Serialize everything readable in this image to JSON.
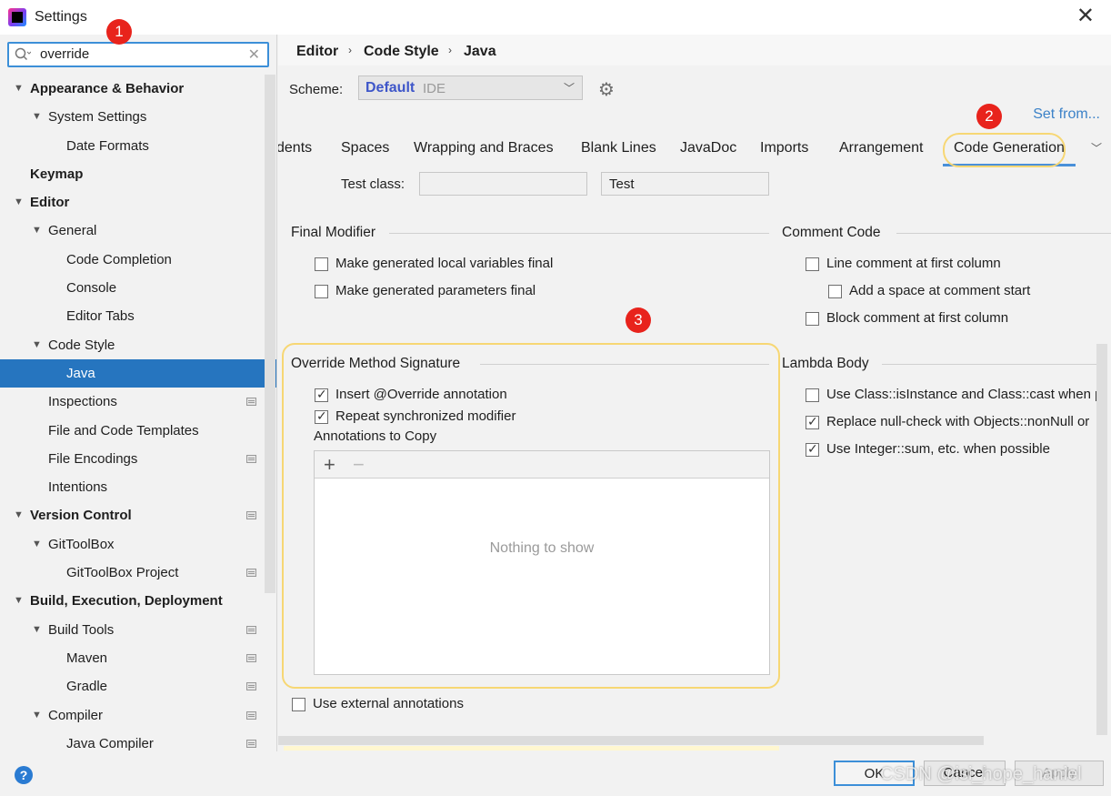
{
  "window": {
    "title": "Settings"
  },
  "search": {
    "value": "override"
  },
  "tree": [
    {
      "label": "Appearance & Behavior",
      "level": 0,
      "expanded": true,
      "bold": true
    },
    {
      "label": "System Settings",
      "level": 1,
      "expanded": true
    },
    {
      "label": "Date Formats",
      "level": 2
    },
    {
      "label": "Keymap",
      "level": 0,
      "bold": true
    },
    {
      "label": "Editor",
      "level": 0,
      "expanded": true,
      "bold": true
    },
    {
      "label": "General",
      "level": 1,
      "expanded": true
    },
    {
      "label": "Code Completion",
      "level": 2
    },
    {
      "label": "Console",
      "level": 2
    },
    {
      "label": "Editor Tabs",
      "level": 2
    },
    {
      "label": "Code Style",
      "level": 1,
      "expanded": true
    },
    {
      "label": "Java",
      "level": 2,
      "selected": true
    },
    {
      "label": "Inspections",
      "level": 1,
      "project": true
    },
    {
      "label": "File and Code Templates",
      "level": 1
    },
    {
      "label": "File Encodings",
      "level": 1,
      "project": true
    },
    {
      "label": "Intentions",
      "level": 1
    },
    {
      "label": "Version Control",
      "level": 0,
      "expanded": true,
      "bold": true,
      "project": true
    },
    {
      "label": "GitToolBox",
      "level": 1,
      "expanded": true
    },
    {
      "label": "GitToolBox Project",
      "level": 2,
      "project": true
    },
    {
      "label": "Build, Execution, Deployment",
      "level": 0,
      "expanded": true,
      "bold": true
    },
    {
      "label": "Build Tools",
      "level": 1,
      "expanded": true,
      "project": true
    },
    {
      "label": "Maven",
      "level": 2,
      "project": true
    },
    {
      "label": "Gradle",
      "level": 2,
      "project": true
    },
    {
      "label": "Compiler",
      "level": 1,
      "expanded": true,
      "project": true
    },
    {
      "label": "Java Compiler",
      "level": 2,
      "project": true
    }
  ],
  "breadcrumb": [
    "Editor",
    "Code Style",
    "Java"
  ],
  "scheme": {
    "label": "Scheme:",
    "name": "Default",
    "kind": "IDE"
  },
  "set_from": "Set from...",
  "tabs": [
    "dents",
    "Spaces",
    "Wrapping and Braces",
    "Blank Lines",
    "JavaDoc",
    "Imports",
    "Arrangement",
    "Code Generation"
  ],
  "active_tab": "Code Generation",
  "test_class": {
    "label": "Test class:",
    "prefix": "",
    "suffix": "Test"
  },
  "final_modifier": {
    "title": "Final Modifier",
    "options": [
      {
        "label": "Make generated local variables final",
        "checked": false
      },
      {
        "label": "Make generated parameters final",
        "checked": false
      }
    ]
  },
  "comment_code": {
    "title": "Comment Code",
    "options": [
      {
        "label": "Line comment at first column",
        "checked": false
      },
      {
        "label": "Add a space at comment start",
        "checked": false
      },
      {
        "label": "Block comment at first column",
        "checked": false
      }
    ]
  },
  "override": {
    "title": "Override Method Signature",
    "options": [
      {
        "label": "Insert @Override annotation",
        "checked": true
      },
      {
        "label": "Repeat synchronized modifier",
        "checked": true
      }
    ],
    "annotations_label": "Annotations to Copy",
    "add": "+",
    "remove": "−",
    "empty": "Nothing to show"
  },
  "lambda": {
    "title": "Lambda Body",
    "options": [
      {
        "label": "Use Class::isInstance and Class::cast when p",
        "checked": false
      },
      {
        "label": "Replace null-check with Objects::nonNull or",
        "checked": true
      },
      {
        "label": "Use Integer::sum, etc. when possible",
        "checked": true
      }
    ]
  },
  "external_annotations": {
    "label": "Use external annotations",
    "checked": false
  },
  "buttons": {
    "ok": "OK",
    "cancel": "Cancel",
    "apply": "Apply"
  },
  "badges": [
    "1",
    "2",
    "3"
  ],
  "help": "?",
  "watermark": "CSDN @isi_hope_haniel",
  "colors": {
    "selection": "#2675bf",
    "accent": "#3c8fd8",
    "scheme": "#3e56c9",
    "highlight": "#f7d774",
    "badge": "#e8231c"
  }
}
